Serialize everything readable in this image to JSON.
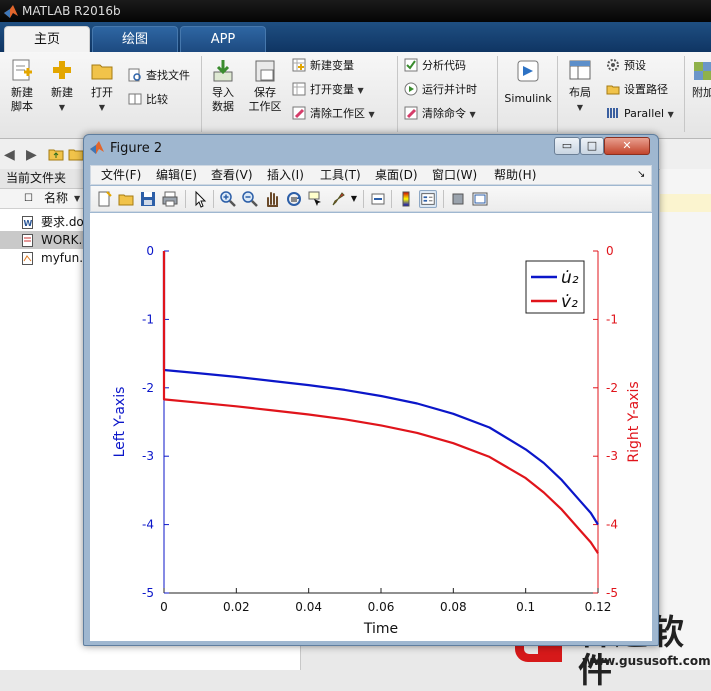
{
  "app": {
    "title": "MATLAB R2016b"
  },
  "tabs": [
    {
      "label": "主页",
      "active": true
    },
    {
      "label": "绘图",
      "active": false
    },
    {
      "label": "APP",
      "active": false
    }
  ],
  "ribbon": {
    "new_script": "新建\n脚本",
    "new": "新建",
    "open": "打开",
    "find_files": "查找文件",
    "compare": "比较",
    "import_data": "导入\n数据",
    "save_workspace": "保存\n工作区",
    "new_variable": "新建变量",
    "open_variable": "打开变量",
    "clear_workspace": "清除工作区",
    "analyze_code": "分析代码",
    "run_and_time": "运行并计时",
    "clear_commands": "清除命令",
    "simulink": "Simulink",
    "layout": "布局",
    "preferences": "预设",
    "set_path": "设置路径",
    "parallel": "Parallel",
    "addons": "附加"
  },
  "left_panel": {
    "title": "当前文件夹",
    "column_header": "名称",
    "files": [
      {
        "name": "要求.do",
        "icon": "word-doc-icon",
        "selected": false
      },
      {
        "name": "WORK.",
        "icon": "doc-icon",
        "selected": true
      },
      {
        "name": "myfun.r",
        "icon": "m-file-icon",
        "selected": false
      }
    ]
  },
  "figure": {
    "title": "Figure 2",
    "window_buttons": {
      "minimize": "▭",
      "maximize": "□",
      "close": "✕"
    },
    "menu": [
      "文件(F)",
      "编辑(E)",
      "查看(V)",
      "插入(I)",
      "工具(T)",
      "桌面(D)",
      "窗口(W)",
      "帮助(H)"
    ],
    "menu_arrow": "↘",
    "toolbar": [
      "new-figure-icon",
      "open-file-icon",
      "save-icon",
      "print-icon",
      "select-arrow-icon",
      "zoom-in-icon",
      "zoom-out-icon",
      "pan-hand-icon",
      "rotate-3d-icon",
      "data-cursor-icon",
      "brush-icon",
      "link-plot-icon",
      "colorbar-icon",
      "legend-icon",
      "hide-plot-tools-icon",
      "show-plot-tools-icon"
    ]
  },
  "chart_data": {
    "type": "line",
    "xlabel": "Time",
    "ylabel_left": "Left Y-axis",
    "ylabel_right": "Right Y-axis",
    "xlim": [
      0,
      0.12
    ],
    "ylim_left": [
      -5,
      0
    ],
    "ylim_right": [
      -5,
      0
    ],
    "x_ticks": [
      "0",
      "0.02",
      "0.04",
      "0.06",
      "0.08",
      "0.1",
      "0.12"
    ],
    "y_ticks_left": [
      "0",
      "-1",
      "-2",
      "-3",
      "-4",
      "-5"
    ],
    "y_ticks_right": [
      "0",
      "-1",
      "-2",
      "-3",
      "-4",
      "-5"
    ],
    "legend_position": "top-right",
    "grid": false,
    "series": [
      {
        "name": "u̇₂",
        "axis": "left",
        "color": "#0b16c9",
        "x": [
          0,
          0,
          0.01,
          0.02,
          0.03,
          0.04,
          0.05,
          0.06,
          0.07,
          0.08,
          0.09,
          0.1,
          0.105,
          0.11,
          0.115,
          0.118,
          0.12
        ],
        "y": [
          0,
          -1.74,
          -1.79,
          -1.84,
          -1.9,
          -1.96,
          -2.03,
          -2.12,
          -2.23,
          -2.38,
          -2.58,
          -2.9,
          -3.1,
          -3.35,
          -3.65,
          -3.83,
          -4.0
        ]
      },
      {
        "name": "v̇₂",
        "axis": "right",
        "color": "#e0141b",
        "x": [
          0,
          0,
          0.01,
          0.02,
          0.03,
          0.04,
          0.05,
          0.06,
          0.07,
          0.08,
          0.09,
          0.1,
          0.105,
          0.11,
          0.115,
          0.118,
          0.12
        ],
        "y": [
          0,
          -2.17,
          -2.22,
          -2.27,
          -2.33,
          -2.39,
          -2.46,
          -2.55,
          -2.66,
          -2.81,
          -3.01,
          -3.32,
          -3.53,
          -3.78,
          -4.08,
          -4.26,
          -4.42
        ]
      }
    ]
  },
  "watermark": {
    "text": "谷速软件",
    "url": "www.gususoft.com",
    "color": "#d6191a"
  }
}
